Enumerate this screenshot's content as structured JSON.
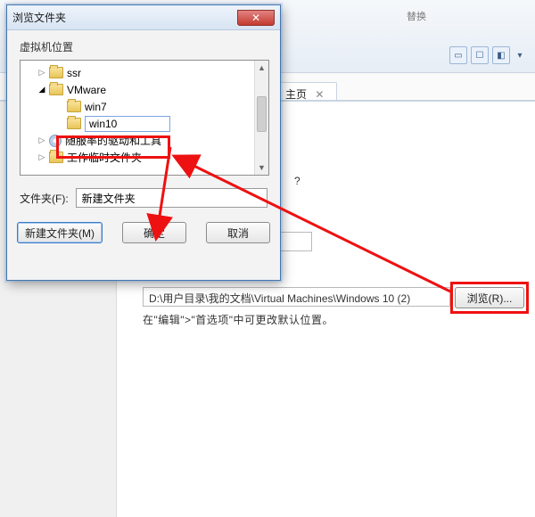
{
  "bg": {
    "replace_label": "替换",
    "tab_label": "主页",
    "question_mark": "?",
    "path_value": "D:\\用户目录\\我的文档\\Virtual Machines\\Windows 10 (2)",
    "browse_label": "浏览(R)...",
    "help_text": "在\"编辑\">\"首选项\"中可更改默认位置。"
  },
  "dialog": {
    "title": "浏览文件夹",
    "section": "虚拟机位置",
    "tree": {
      "ssr": "ssr",
      "vmware": "VMware",
      "win7": "win7",
      "win10": "win10",
      "drivers": "随服率的驱动和工具",
      "temp": "工作临时文件夹"
    },
    "folder_label": "文件夹(F):",
    "folder_value": "新建文件夹",
    "newfolder_btn": "新建文件夹(M)",
    "ok_btn": "确定",
    "cancel_btn": "取消"
  },
  "icons": {
    "close": "✕",
    "tri_right": "▷",
    "tri_down": "▽",
    "tri_solid": "▾",
    "up": "▲",
    "down": "▼",
    "ribbon_a": "A"
  }
}
